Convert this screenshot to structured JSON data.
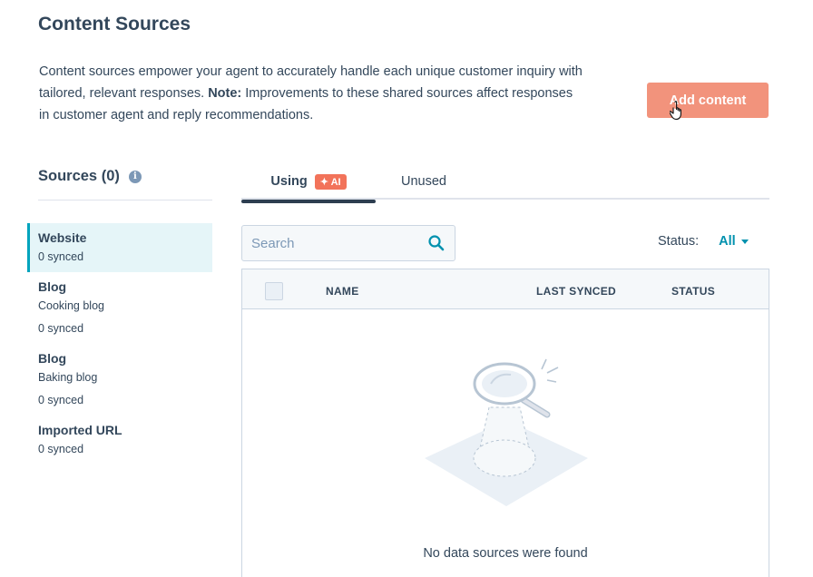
{
  "page": {
    "title": "Content Sources",
    "description_part1": "Content sources empower your agent to accurately handle each unique customer inquiry with tailored, relevant responses. ",
    "description_note_label": "Note:",
    "description_part2": " Improvements to these shared sources affect responses in customer agent and reply recommendations.",
    "add_button_label": "Add content"
  },
  "sidebar": {
    "heading": "Sources (0)",
    "info_icon": "info-icon",
    "items": [
      {
        "name": "Website",
        "sub": "",
        "meta": "0 synced",
        "active": true
      },
      {
        "name": "Blog",
        "sub": "Cooking blog",
        "meta": "0 synced",
        "active": false
      },
      {
        "name": "Blog",
        "sub": "Baking blog",
        "meta": "0 synced",
        "active": false
      },
      {
        "name": "Imported URL",
        "sub": "",
        "meta": "0 synced",
        "active": false
      }
    ]
  },
  "tabs": {
    "using_label": "Using",
    "ai_badge": "✦ AI",
    "unused_label": "Unused"
  },
  "search": {
    "placeholder": "Search",
    "icon": "search-icon"
  },
  "status_filter": {
    "label": "Status:",
    "value": "All"
  },
  "table": {
    "columns": [
      "NAME",
      "LAST SYNCED",
      "STATUS"
    ],
    "rows": [],
    "empty_message": "No data sources were found"
  },
  "colors": {
    "accent_button": "#f2937c",
    "active_border": "#00a4bd",
    "active_bg": "#e5f5f8",
    "link": "#0091ae",
    "text": "#33475b"
  }
}
